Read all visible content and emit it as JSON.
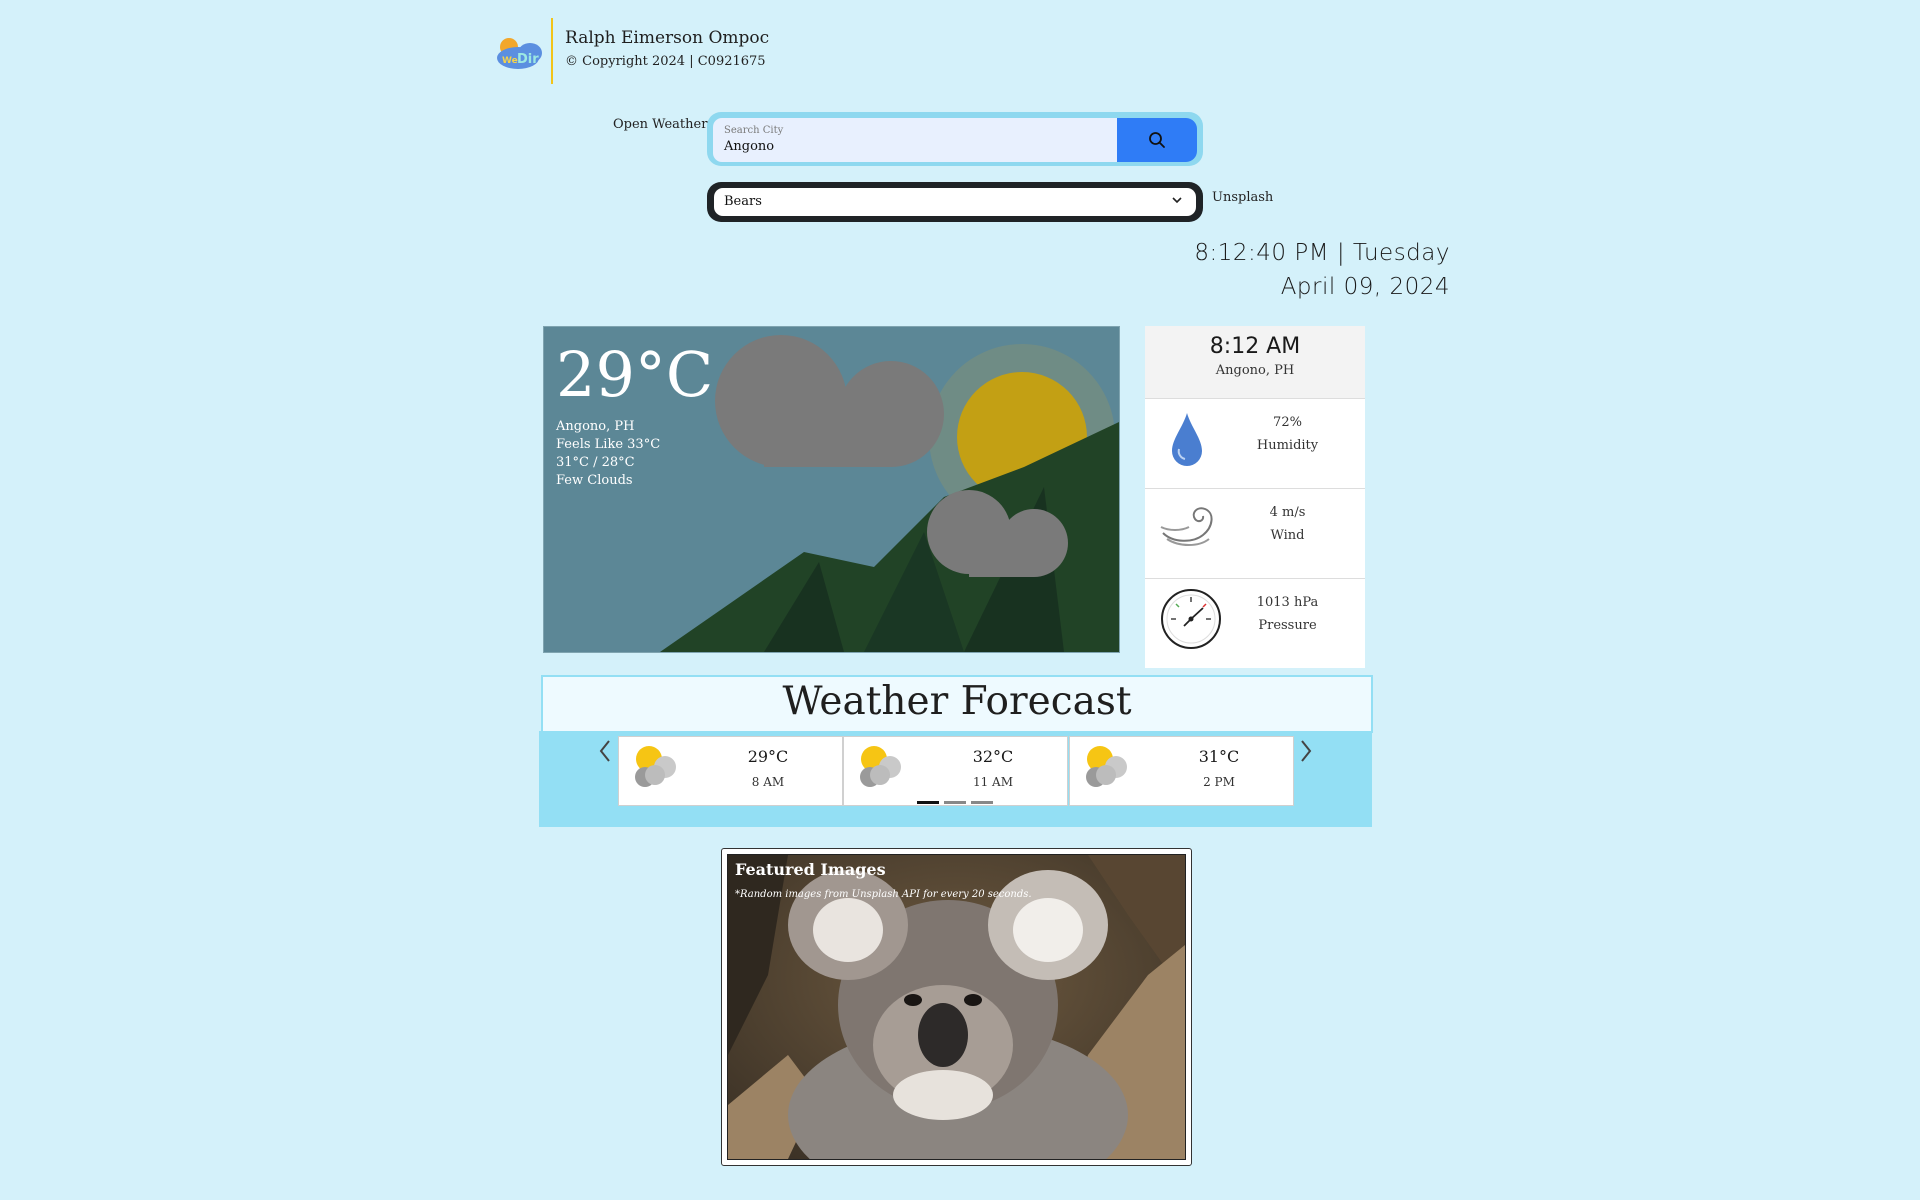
{
  "header": {
    "logo_text": "WeDir",
    "author": "Ralph Eimerson Ompoc",
    "copyright": "© Copyright 2024 | C0921675"
  },
  "search": {
    "provider_label": "Open Weather",
    "placeholder": "Search City",
    "value": "Angono",
    "button_icon": "search-icon"
  },
  "image_source": {
    "selected": "Bears",
    "provider_label": "Unsplash"
  },
  "clock": {
    "time_day": "8:12:40 PM | Tuesday",
    "date": "April 09, 2024"
  },
  "current": {
    "temperature": "29°C",
    "location": "Angono, PH",
    "feels_like": "Feels Like 33°C",
    "high_low": "31°C / 28°C",
    "condition": "Few Clouds"
  },
  "side_panel": {
    "time": "8:12 AM",
    "location": "Angono, PH",
    "stats": [
      {
        "icon": "water-drop-icon",
        "value": "72%",
        "label": "Humidity"
      },
      {
        "icon": "wind-icon",
        "value": "4 m/s",
        "label": "Wind"
      },
      {
        "icon": "barometer-icon",
        "value": "1013 hPa",
        "label": "Pressure"
      }
    ]
  },
  "forecast": {
    "title": "Weather Forecast",
    "items": [
      {
        "icon": "partly-cloudy-icon",
        "temp": "29°C",
        "time": "8 AM"
      },
      {
        "icon": "partly-cloudy-icon",
        "temp": "32°C",
        "time": "11 AM"
      },
      {
        "icon": "partly-cloudy-icon",
        "temp": "31°C",
        "time": "2 PM"
      }
    ],
    "active_page": 1,
    "page_count": 3
  },
  "featured": {
    "title": "Featured Images",
    "subtitle": "*Random images from Unsplash API for every 20 seconds."
  },
  "colors": {
    "background": "#d4f1fa",
    "accent_blue": "#2f7cf6",
    "panel_blue": "#93dff4"
  }
}
